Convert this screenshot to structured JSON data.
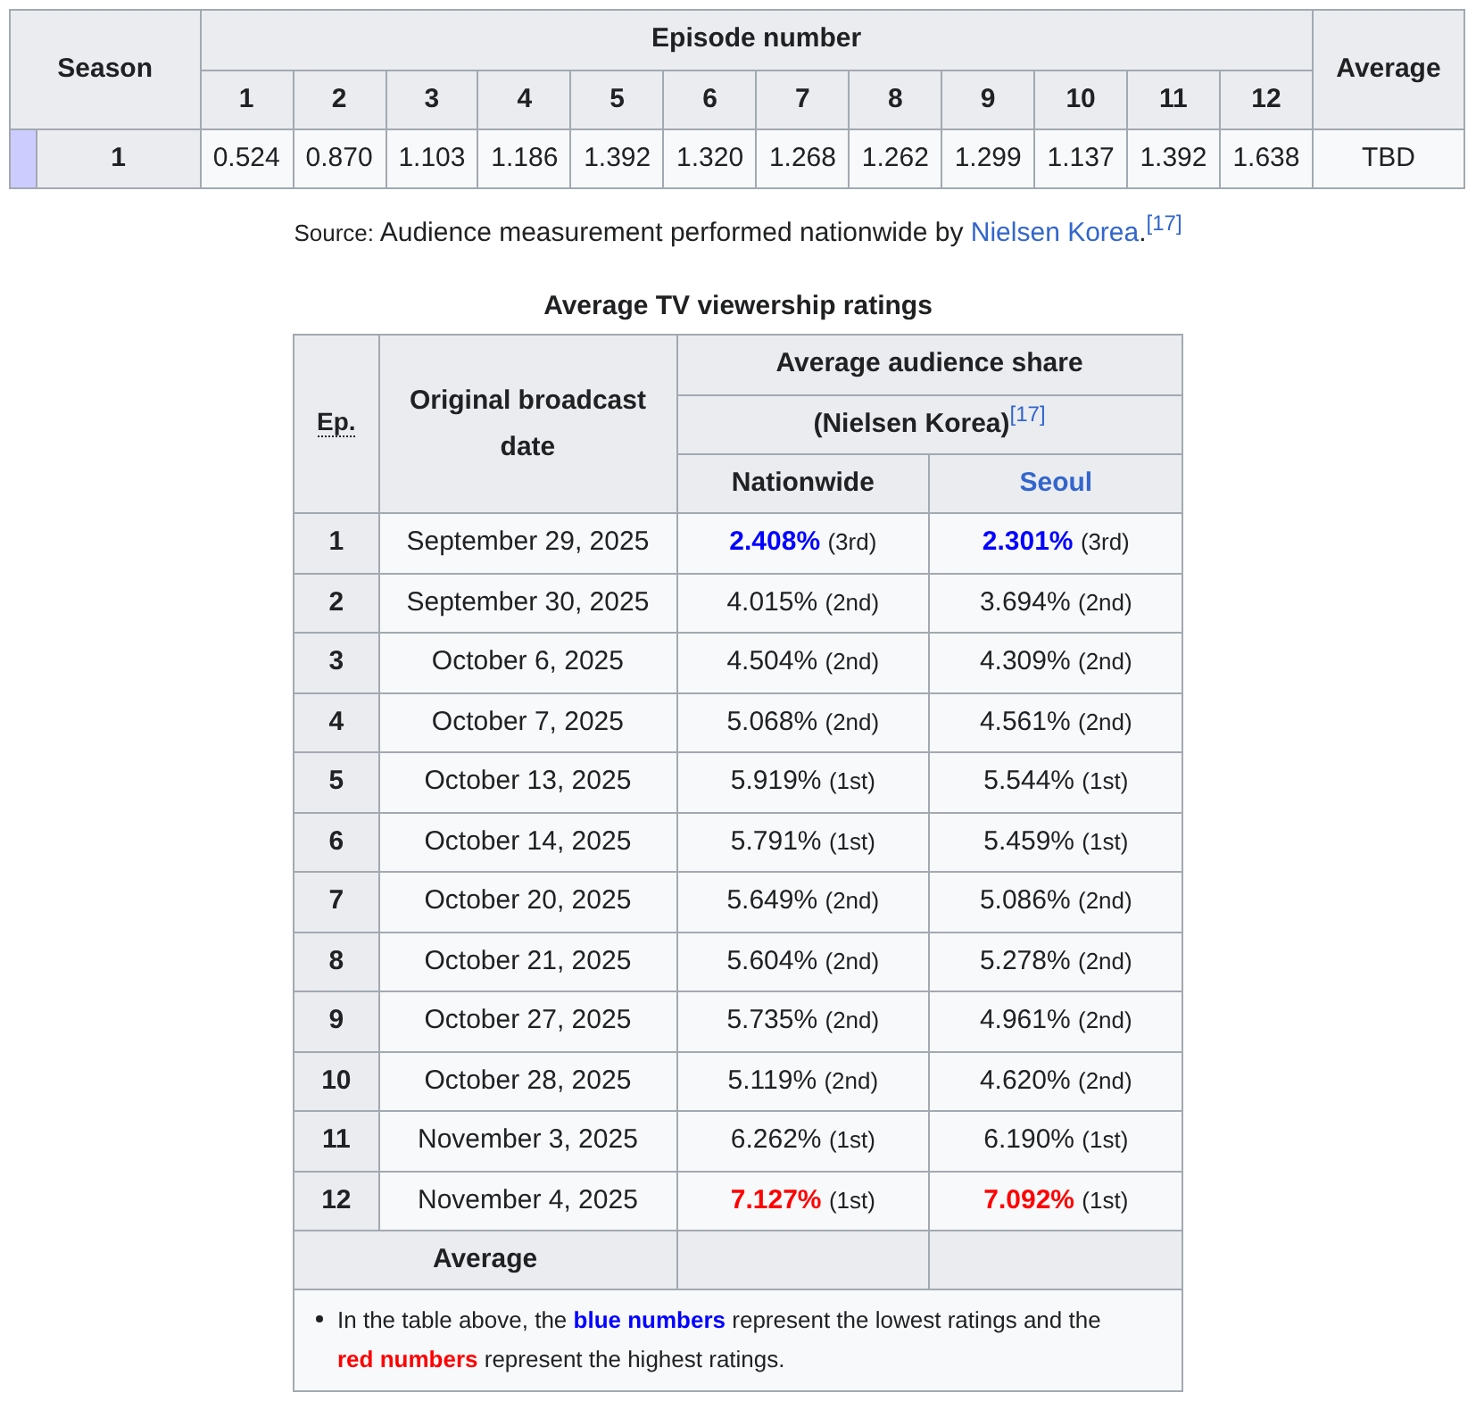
{
  "season_table": {
    "headers": {
      "season": "Season",
      "episode_number": "Episode number",
      "average": "Average"
    },
    "episodes": [
      "1",
      "2",
      "3",
      "4",
      "5",
      "6",
      "7",
      "8",
      "9",
      "10",
      "11",
      "12"
    ],
    "rows": [
      {
        "color": "#ccccff",
        "season": "1",
        "ratings": [
          "0.524",
          "0.870",
          "1.103",
          "1.186",
          "1.392",
          "1.320",
          "1.268",
          "1.262",
          "1.299",
          "1.137",
          "1.392",
          "1.638"
        ],
        "average": "TBD"
      }
    ]
  },
  "source": {
    "label": "Source:",
    "text": "Audience measurement performed nationwide by",
    "link": "Nielsen Korea",
    "after": ".",
    "citation": "[17]"
  },
  "ratings_table": {
    "title": "Average TV viewership ratings",
    "headers": {
      "ep": "Ep.",
      "date": "Original broadcast date",
      "share": "Average audience share",
      "source": "(Nielsen Korea)",
      "citation": "[17]"
    },
    "columns": [
      {
        "label": "Nationwide",
        "link": false
      },
      {
        "label": "Seoul",
        "link": true
      }
    ],
    "rows": [
      {
        "ep": "1",
        "date": "September 29, 2025",
        "ratings": [
          {
            "value": "2.408%",
            "rank": "(3rd)",
            "color": "#0000ff"
          },
          {
            "value": "2.301%",
            "rank": "(3rd)",
            "color": "#0000ff"
          }
        ]
      },
      {
        "ep": "2",
        "date": "September 30, 2025",
        "ratings": [
          {
            "value": "4.015%",
            "rank": "(2nd)"
          },
          {
            "value": "3.694%",
            "rank": "(2nd)"
          }
        ]
      },
      {
        "ep": "3",
        "date": "October 6, 2025",
        "ratings": [
          {
            "value": "4.504%",
            "rank": "(2nd)"
          },
          {
            "value": "4.309%",
            "rank": "(2nd)"
          }
        ]
      },
      {
        "ep": "4",
        "date": "October 7, 2025",
        "ratings": [
          {
            "value": "5.068%",
            "rank": "(2nd)"
          },
          {
            "value": "4.561%",
            "rank": "(2nd)"
          }
        ]
      },
      {
        "ep": "5",
        "date": "October 13, 2025",
        "ratings": [
          {
            "value": "5.919%",
            "rank": "(1st)"
          },
          {
            "value": "5.544%",
            "rank": "(1st)"
          }
        ]
      },
      {
        "ep": "6",
        "date": "October 14, 2025",
        "ratings": [
          {
            "value": "5.791%",
            "rank": "(1st)"
          },
          {
            "value": "5.459%",
            "rank": "(1st)"
          }
        ]
      },
      {
        "ep": "7",
        "date": "October 20, 2025",
        "ratings": [
          {
            "value": "5.649%",
            "rank": "(2nd)"
          },
          {
            "value": "5.086%",
            "rank": "(2nd)"
          }
        ]
      },
      {
        "ep": "8",
        "date": "October 21, 2025",
        "ratings": [
          {
            "value": "5.604%",
            "rank": "(2nd)"
          },
          {
            "value": "5.278%",
            "rank": "(2nd)"
          }
        ]
      },
      {
        "ep": "9",
        "date": "October 27, 2025",
        "ratings": [
          {
            "value": "5.735%",
            "rank": "(2nd)"
          },
          {
            "value": "4.961%",
            "rank": "(2nd)"
          }
        ]
      },
      {
        "ep": "10",
        "date": "October 28, 2025",
        "ratings": [
          {
            "value": "5.119%",
            "rank": "(2nd)"
          },
          {
            "value": "4.620%",
            "rank": "(2nd)"
          }
        ]
      },
      {
        "ep": "11",
        "date": "November 3, 2025",
        "ratings": [
          {
            "value": "6.262%",
            "rank": "(1st)"
          },
          {
            "value": "6.190%",
            "rank": "(1st)"
          }
        ]
      },
      {
        "ep": "12",
        "date": "November 4, 2025",
        "ratings": [
          {
            "value": "7.127%",
            "rank": "(1st)",
            "color": "#ff0000"
          },
          {
            "value": "7.092%",
            "rank": "(1st)",
            "color": "#ff0000"
          }
        ]
      }
    ],
    "average_label": "Average",
    "note": [
      {
        "text": "In the table above, the "
      },
      {
        "text": "blue numbers",
        "color": "#0000ff"
      },
      {
        "text": " represent the lowest ratings and the "
      },
      {
        "text": "red numbers",
        "color": "#ff0000"
      },
      {
        "text": " represent the highest ratings."
      }
    ]
  }
}
